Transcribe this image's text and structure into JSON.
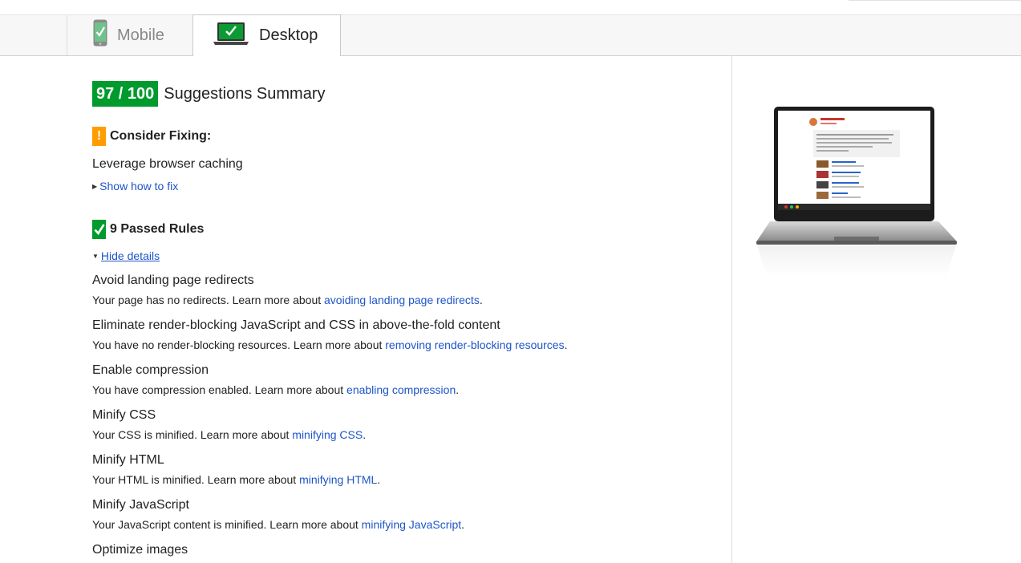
{
  "tabs": [
    {
      "label": "Mobile",
      "active": false
    },
    {
      "label": "Desktop",
      "active": true
    }
  ],
  "score": "97 / 100",
  "summary_title": "Suggestions Summary",
  "consider": {
    "badge": "!",
    "heading": "Consider Fixing:",
    "rule": "Leverage browser caching",
    "show_fix": "Show how to fix"
  },
  "passed": {
    "heading": "9 Passed Rules",
    "hide_details": "Hide details",
    "rules": [
      {
        "name": "Avoid landing page redirects",
        "desc": "Your page has no redirects. Learn more about ",
        "link": "avoiding landing page redirects",
        "end": "."
      },
      {
        "name": "Eliminate render-blocking JavaScript and CSS in above-the-fold content",
        "desc": "You have no render-blocking resources. Learn more about ",
        "link": "removing render-blocking resources",
        "end": "."
      },
      {
        "name": "Enable compression",
        "desc": "You have compression enabled. Learn more about ",
        "link": "enabling compression",
        "end": "."
      },
      {
        "name": "Minify CSS",
        "desc": "Your CSS is minified. Learn more about ",
        "link": "minifying CSS",
        "end": "."
      },
      {
        "name": "Minify HTML",
        "desc": "Your HTML is minified. Learn more about ",
        "link": "minifying HTML",
        "end": "."
      },
      {
        "name": "Minify JavaScript",
        "desc": "Your JavaScript content is minified. Learn more about ",
        "link": "minifying JavaScript",
        "end": "."
      },
      {
        "name": "Optimize images"
      }
    ]
  },
  "colors": {
    "score_green": "#009a2d",
    "warn_orange": "#ff9d00",
    "link_blue": "#1e55c8"
  },
  "icons": [
    "mobile-phone-check-icon",
    "laptop-check-icon",
    "warning-icon",
    "check-icon",
    "triangle-right-icon",
    "triangle-down-icon"
  ]
}
